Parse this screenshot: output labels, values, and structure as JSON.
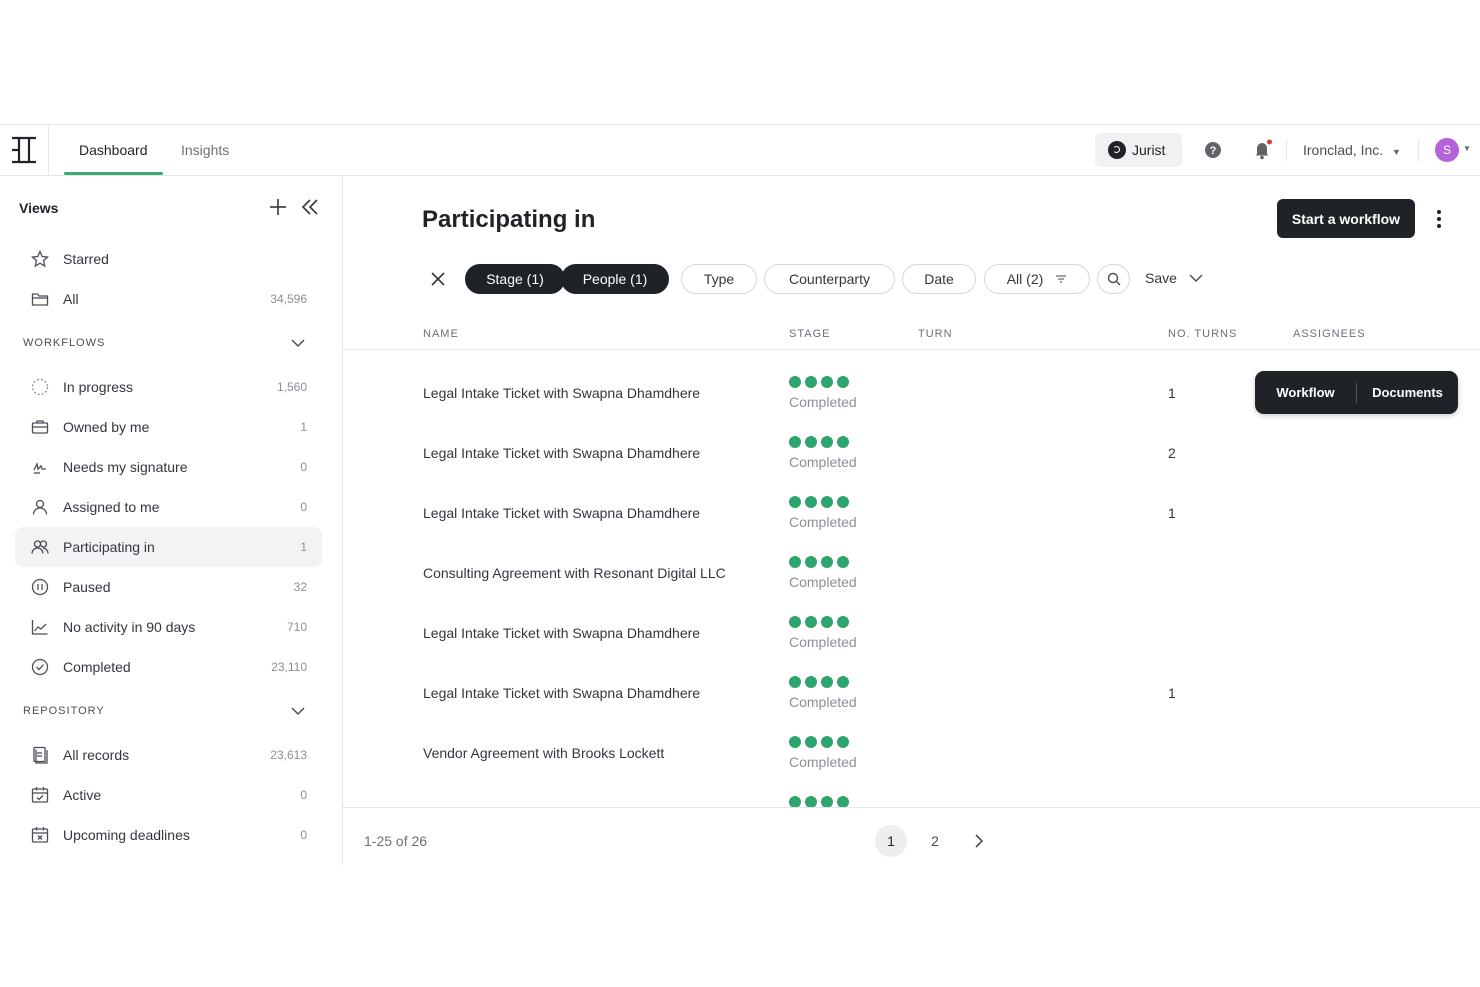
{
  "header": {
    "tabs": [
      {
        "label": "Dashboard",
        "active": true
      },
      {
        "label": "Insights",
        "active": false
      }
    ],
    "jurist_label": "Jurist",
    "company": "Ironclad, Inc.",
    "avatar_initial": "S",
    "icons": [
      "ironclad-logo-icon",
      "help-icon",
      "bell-icon"
    ]
  },
  "sidebar": {
    "title": "Views",
    "items_top": [
      {
        "label": "Starred",
        "count": "",
        "icon": "star-icon"
      },
      {
        "label": "All",
        "count": "34,596",
        "icon": "folder-icon"
      }
    ],
    "workflows_section": "WORKFLOWS",
    "workflows": [
      {
        "label": "In progress",
        "count": "1,560",
        "icon": "progress-icon"
      },
      {
        "label": "Owned by me",
        "count": "1",
        "icon": "briefcase-icon"
      },
      {
        "label": "Needs my signature",
        "count": "0",
        "icon": "signature-icon"
      },
      {
        "label": "Assigned to me",
        "count": "0",
        "icon": "user-icon"
      },
      {
        "label": "Participating in",
        "count": "1",
        "icon": "users-icon",
        "selected": true
      },
      {
        "label": "Paused",
        "count": "32",
        "icon": "pause-icon"
      },
      {
        "label": "No activity in 90 days",
        "count": "710",
        "icon": "chart-icon"
      },
      {
        "label": "Completed",
        "count": "23,110",
        "icon": "check-circle-icon"
      }
    ],
    "repository_section": "REPOSITORY",
    "repository": [
      {
        "label": "All records",
        "count": "23,613",
        "icon": "records-icon"
      },
      {
        "label": "Active",
        "count": "0",
        "icon": "calendar-check-icon"
      },
      {
        "label": "Upcoming deadlines",
        "count": "0",
        "icon": "calendar-x-icon"
      }
    ]
  },
  "main": {
    "title": "Participating in",
    "start_button": "Start a workflow",
    "filters": {
      "stage": "Stage (1)",
      "people": "People (1)",
      "type": "Type",
      "counterparty": "Counterparty",
      "date": "Date",
      "all": "All (2)",
      "save": "Save"
    },
    "columns": {
      "name": "NAME",
      "stage": "STAGE",
      "turn": "TURN",
      "turns": "NO. TURNS",
      "assignees": "ASSIGNEES"
    },
    "rows": [
      {
        "name": "Legal Intake Ticket with Swapna Dhamdhere",
        "stage": "Completed",
        "turns": "1"
      },
      {
        "name": "Legal Intake Ticket with Swapna Dhamdhere",
        "stage": "Completed",
        "turns": "2"
      },
      {
        "name": "Legal Intake Ticket with Swapna Dhamdhere",
        "stage": "Completed",
        "turns": "1"
      },
      {
        "name": "Consulting Agreement with Resonant Digital LLC",
        "stage": "Completed",
        "turns": ""
      },
      {
        "name": "Legal Intake Ticket with Swapna Dhamdhere",
        "stage": "Completed",
        "turns": ""
      },
      {
        "name": "Legal Intake Ticket with Swapna Dhamdhere",
        "stage": "Completed",
        "turns": "1"
      },
      {
        "name": "Vendor Agreement with Brooks Lockett",
        "stage": "Completed",
        "turns": ""
      }
    ],
    "hover_actions": {
      "workflow": "Workflow",
      "documents": "Documents"
    },
    "pagination": {
      "range": "1-25 of 26",
      "pages": [
        "1",
        "2"
      ],
      "current": "1"
    },
    "stage_color": "#2fa56e"
  }
}
